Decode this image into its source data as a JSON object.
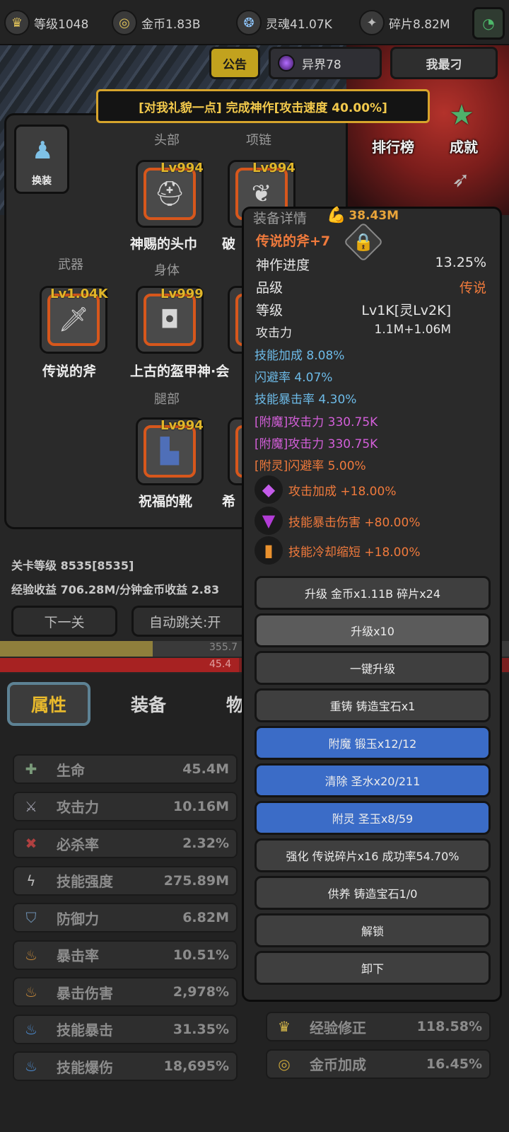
{
  "topbar": {
    "level": "等级1048",
    "coins": "金币1.83B",
    "souls": "灵魂41.07K",
    "fragments": "碎片8.82M"
  },
  "tabs": {
    "notice": "公告",
    "world": "异界78",
    "me": "我最刁"
  },
  "banner": "[对我礼貌一点] 完成神作[攻击速度 40.00%]",
  "side_menu": {
    "rank": "排行榜",
    "achievement": "成就"
  },
  "equipment": {
    "swap_label": "换装",
    "slots": {
      "head_label": "头部",
      "necklace_label": "项链",
      "weapon_label": "武器",
      "body_label": "身体",
      "legs_label": "腿部"
    },
    "items": {
      "head": {
        "level": "Lv994",
        "name": "神赐的头巾"
      },
      "necklace": {
        "level": "Lv994",
        "name": "破"
      },
      "weapon": {
        "level": "Lv1.04K",
        "name": "传说的斧"
      },
      "body": {
        "level": "Lv999",
        "name": "上古的盔甲神·会"
      },
      "legs": {
        "level": "Lv994",
        "name": "祝福的靴"
      },
      "legs2": {
        "name": "希"
      }
    }
  },
  "stage": {
    "level_line": "关卡等级 8535[8535]",
    "income_line": "经验收益 706.28M/分钟金币收益 2.83",
    "next_button": "下一关",
    "auto_skip_button": "自动跳关:开",
    "exp_text": "355.7",
    "exp_fill": 0.3,
    "hp_text": "45.4",
    "hp_fill": 0.47
  },
  "bottom_tabs": {
    "attributes": "属性",
    "equipment": "装备",
    "more": "物"
  },
  "stats_left": [
    {
      "icon": "life-icon",
      "name": "生命",
      "value": "45.4M"
    },
    {
      "icon": "sword-icon",
      "name": "攻击力",
      "value": "10.16M"
    },
    {
      "icon": "crit-icon",
      "name": "必杀率",
      "value": "2.32%"
    },
    {
      "icon": "lightning-icon",
      "name": "技能强度",
      "value": "275.89M"
    },
    {
      "icon": "shield-icon",
      "name": "防御力",
      "value": "6.82M"
    },
    {
      "icon": "flame-icon",
      "name": "暴击率",
      "value": "10.51%"
    },
    {
      "icon": "flame-icon",
      "name": "暴击伤害",
      "value": "2,978%"
    },
    {
      "icon": "blue-flame-icon",
      "name": "技能暴击",
      "value": "31.35%"
    },
    {
      "icon": "blue-flame-icon",
      "name": "技能爆伤",
      "value": "18,695%"
    }
  ],
  "stats_right": [
    {
      "icon": "crown-icon",
      "name": "经验修正",
      "value": "118.58%"
    },
    {
      "icon": "coin-icon",
      "name": "金币加成",
      "value": "16.45%"
    }
  ],
  "detail": {
    "title": "装备详情",
    "power": "38.43M",
    "name": "传说的斧+7",
    "rows": [
      {
        "k": "神作进度",
        "v": "13.25%"
      },
      {
        "k": "品级",
        "v": "传说"
      },
      {
        "k": "等级",
        "v": "Lv1K[灵Lv2K]"
      },
      {
        "k": "攻击力",
        "v": "1.1M+1.06M"
      }
    ],
    "lines": [
      "技能加成 8.08%",
      "闪避率 4.07%",
      "技能暴击率 4.30%",
      "[附魔]攻击力 330.75K",
      "[附魔]攻击力 330.75K",
      "[附灵]闪避率 5.00%"
    ],
    "gems": [
      "攻击加成 +18.00%",
      "技能暴击伤害 +80.00%",
      "技能冷却缩短 +18.00%"
    ],
    "buttons": [
      "升级 金币x1.11B 碎片x24",
      "升级x10",
      "一键升级",
      "重铸 铸造宝石x1",
      "附魔 锻玉x12/12",
      "清除 圣水x20/211",
      "附灵 圣玉x8/59",
      "强化 传说碎片x16 成功率54.70%",
      "供养 铸造宝石1/0",
      "解锁",
      "卸下"
    ]
  },
  "colors": {
    "accent_gold": "#e0b62a",
    "legend_orange": "#f07a3c",
    "skill_blue": "#6dbbe8",
    "enchant_purple": "#d35fd9",
    "action_blue": "#3b6cc7"
  }
}
